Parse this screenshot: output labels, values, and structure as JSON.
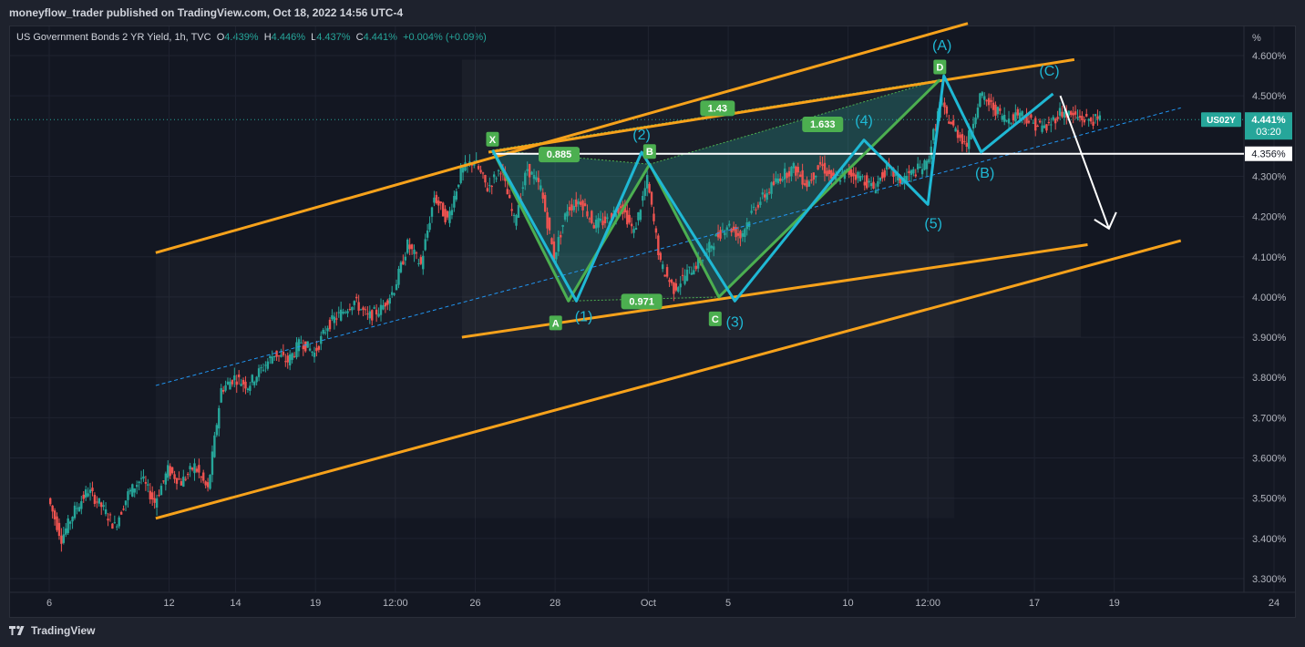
{
  "header": {
    "published": "moneyflow_trader published on TradingView.com, Oct 18, 2022 14:56 UTC-4"
  },
  "legend": {
    "symbol": "US Government Bonds 2 YR Yield, 1h, TVC",
    "o_label": "O",
    "o": "4.439%",
    "h_label": "H",
    "h": "4.446%",
    "l_label": "L",
    "l": "4.437%",
    "c_label": "C",
    "c": "4.441%",
    "change": "+0.004% (+0.09%)"
  },
  "footer": {
    "brand": "TradingView"
  },
  "colors": {
    "up": "#26a69a",
    "down": "#ef5350",
    "channel": "#f7a21b",
    "harmonic": "#4caf50",
    "wave": "#1fb8d4",
    "midline": "#2962ff"
  },
  "chart_data": {
    "type": "line",
    "y_unit": "%",
    "ylim": [
      3.26,
      4.7
    ],
    "y_ticks": [
      "4.600%",
      "4.500%",
      "4.300%",
      "4.200%",
      "4.100%",
      "4.000%",
      "3.900%",
      "3.800%",
      "3.700%",
      "3.600%",
      "3.500%",
      "3.400%",
      "3.300%"
    ],
    "x_ticks": [
      {
        "t": 0,
        "label": "6"
      },
      {
        "t": 9,
        "label": "12"
      },
      {
        "t": 14,
        "label": "14"
      },
      {
        "t": 20,
        "label": "19"
      },
      {
        "t": 26,
        "label": "12:00"
      },
      {
        "t": 32,
        "label": "26"
      },
      {
        "t": 38,
        "label": "28"
      },
      {
        "t": 45,
        "label": "Oct"
      },
      {
        "t": 51,
        "label": "5"
      },
      {
        "t": 60,
        "label": "10"
      },
      {
        "t": 66,
        "label": "12:00"
      },
      {
        "t": 74,
        "label": "17"
      },
      {
        "t": 80,
        "label": "19"
      },
      {
        "t": 92,
        "label": "24"
      }
    ],
    "price_tag": {
      "symbol": "US02Y",
      "value": "4.441%",
      "countdown": "03:20",
      "y": 4.441
    },
    "level_tag": {
      "value": "4.356%",
      "y": 4.356
    },
    "price_path": [
      [
        0,
        3.5
      ],
      [
        1,
        3.4
      ],
      [
        2,
        3.47
      ],
      [
        3,
        3.52
      ],
      [
        4,
        3.48
      ],
      [
        5,
        3.43
      ],
      [
        6,
        3.51
      ],
      [
        7,
        3.55
      ],
      [
        8,
        3.49
      ],
      [
        9,
        3.57
      ],
      [
        10,
        3.54
      ],
      [
        11,
        3.58
      ],
      [
        12,
        3.52
      ],
      [
        13,
        3.77
      ],
      [
        14,
        3.8
      ],
      [
        15,
        3.78
      ],
      [
        16,
        3.82
      ],
      [
        17,
        3.86
      ],
      [
        18,
        3.84
      ],
      [
        19,
        3.89
      ],
      [
        20,
        3.86
      ],
      [
        21,
        3.93
      ],
      [
        22,
        3.96
      ],
      [
        23,
        3.99
      ],
      [
        24,
        3.95
      ],
      [
        25,
        3.97
      ],
      [
        26,
        4.02
      ],
      [
        27,
        4.13
      ],
      [
        28,
        4.08
      ],
      [
        29,
        4.25
      ],
      [
        30,
        4.19
      ],
      [
        31,
        4.31
      ],
      [
        32,
        4.34
      ],
      [
        33,
        4.27
      ],
      [
        34,
        4.32
      ],
      [
        35,
        4.19
      ],
      [
        36,
        4.32
      ],
      [
        37,
        4.27
      ],
      [
        38,
        4.1
      ],
      [
        39,
        4.22
      ],
      [
        40,
        4.24
      ],
      [
        41,
        4.18
      ],
      [
        42,
        4.19
      ],
      [
        43,
        4.23
      ],
      [
        44,
        4.16
      ],
      [
        45,
        4.29
      ],
      [
        46,
        4.08
      ],
      [
        47,
        4.02
      ],
      [
        48,
        4.06
      ],
      [
        49,
        4.09
      ],
      [
        50,
        4.14
      ],
      [
        51,
        4.18
      ],
      [
        52,
        4.15
      ],
      [
        53,
        4.22
      ],
      [
        54,
        4.26
      ],
      [
        55,
        4.3
      ],
      [
        56,
        4.32
      ],
      [
        57,
        4.28
      ],
      [
        58,
        4.33
      ],
      [
        59,
        4.29
      ],
      [
        60,
        4.31
      ],
      [
        61,
        4.3
      ],
      [
        62,
        4.27
      ],
      [
        63,
        4.32
      ],
      [
        64,
        4.29
      ],
      [
        65,
        4.31
      ],
      [
        66,
        4.33
      ],
      [
        67,
        4.48
      ],
      [
        68,
        4.42
      ],
      [
        69,
        4.38
      ],
      [
        70,
        4.5
      ],
      [
        71,
        4.47
      ],
      [
        72,
        4.44
      ],
      [
        73,
        4.46
      ],
      [
        74,
        4.43
      ],
      [
        75,
        4.42
      ],
      [
        76,
        4.46
      ],
      [
        77,
        4.45
      ],
      [
        78,
        4.44
      ],
      [
        79,
        4.44
      ]
    ],
    "channel_lines": [
      {
        "p1": [
          8,
          4.11
        ],
        "p2": [
          69,
          4.68
        ]
      },
      {
        "p1": [
          8,
          3.45
        ],
        "p2": [
          85,
          4.14
        ]
      },
      {
        "p1": [
          33,
          4.36
        ],
        "p2": [
          77,
          4.59
        ]
      },
      {
        "p1": [
          31,
          3.9
        ],
        "p2": [
          78,
          4.13
        ]
      }
    ],
    "midline": {
      "p1": [
        8,
        3.78
      ],
      "p2": [
        85,
        4.47
      ]
    },
    "harmonic": {
      "points": [
        {
          "label": "X",
          "t": 33.3,
          "y": 4.365
        },
        {
          "label": "A",
          "t": 39.0,
          "y": 3.99
        },
        {
          "label": "B",
          "t": 45.1,
          "y": 4.33
        },
        {
          "label": "C",
          "t": 50.3,
          "y": 4.0
        },
        {
          "label": "D",
          "t": 66.9,
          "y": 4.54
        }
      ],
      "ratios": [
        {
          "text": "0.885",
          "t": 38.3,
          "y": 4.355
        },
        {
          "text": "1.43",
          "t": 50.2,
          "y": 4.47
        },
        {
          "text": "0.971",
          "t": 44.5,
          "y": 3.99
        },
        {
          "text": "1.633",
          "t": 58.1,
          "y": 4.43
        }
      ]
    },
    "waves": {
      "points": [
        {
          "t": 33.3,
          "y": 4.365
        },
        {
          "t": 39.6,
          "y": 3.99,
          "label": "(1)"
        },
        {
          "t": 44.5,
          "y": 4.36,
          "label": "(2)"
        },
        {
          "t": 51.5,
          "y": 3.99,
          "label": "(3)"
        },
        {
          "t": 61.2,
          "y": 4.39,
          "label": "(4)"
        },
        {
          "t": 66.0,
          "y": 4.23,
          "label": "(5)"
        },
        {
          "t": 67.2,
          "y": 4.55,
          "label": "(A)"
        },
        {
          "t": 70.0,
          "y": 4.36,
          "label": "(B)"
        },
        {
          "t": 75.4,
          "y": 4.505,
          "label": "(C)"
        }
      ]
    },
    "level_line": {
      "y": 4.356,
      "t_start": 33.3
    }
  }
}
